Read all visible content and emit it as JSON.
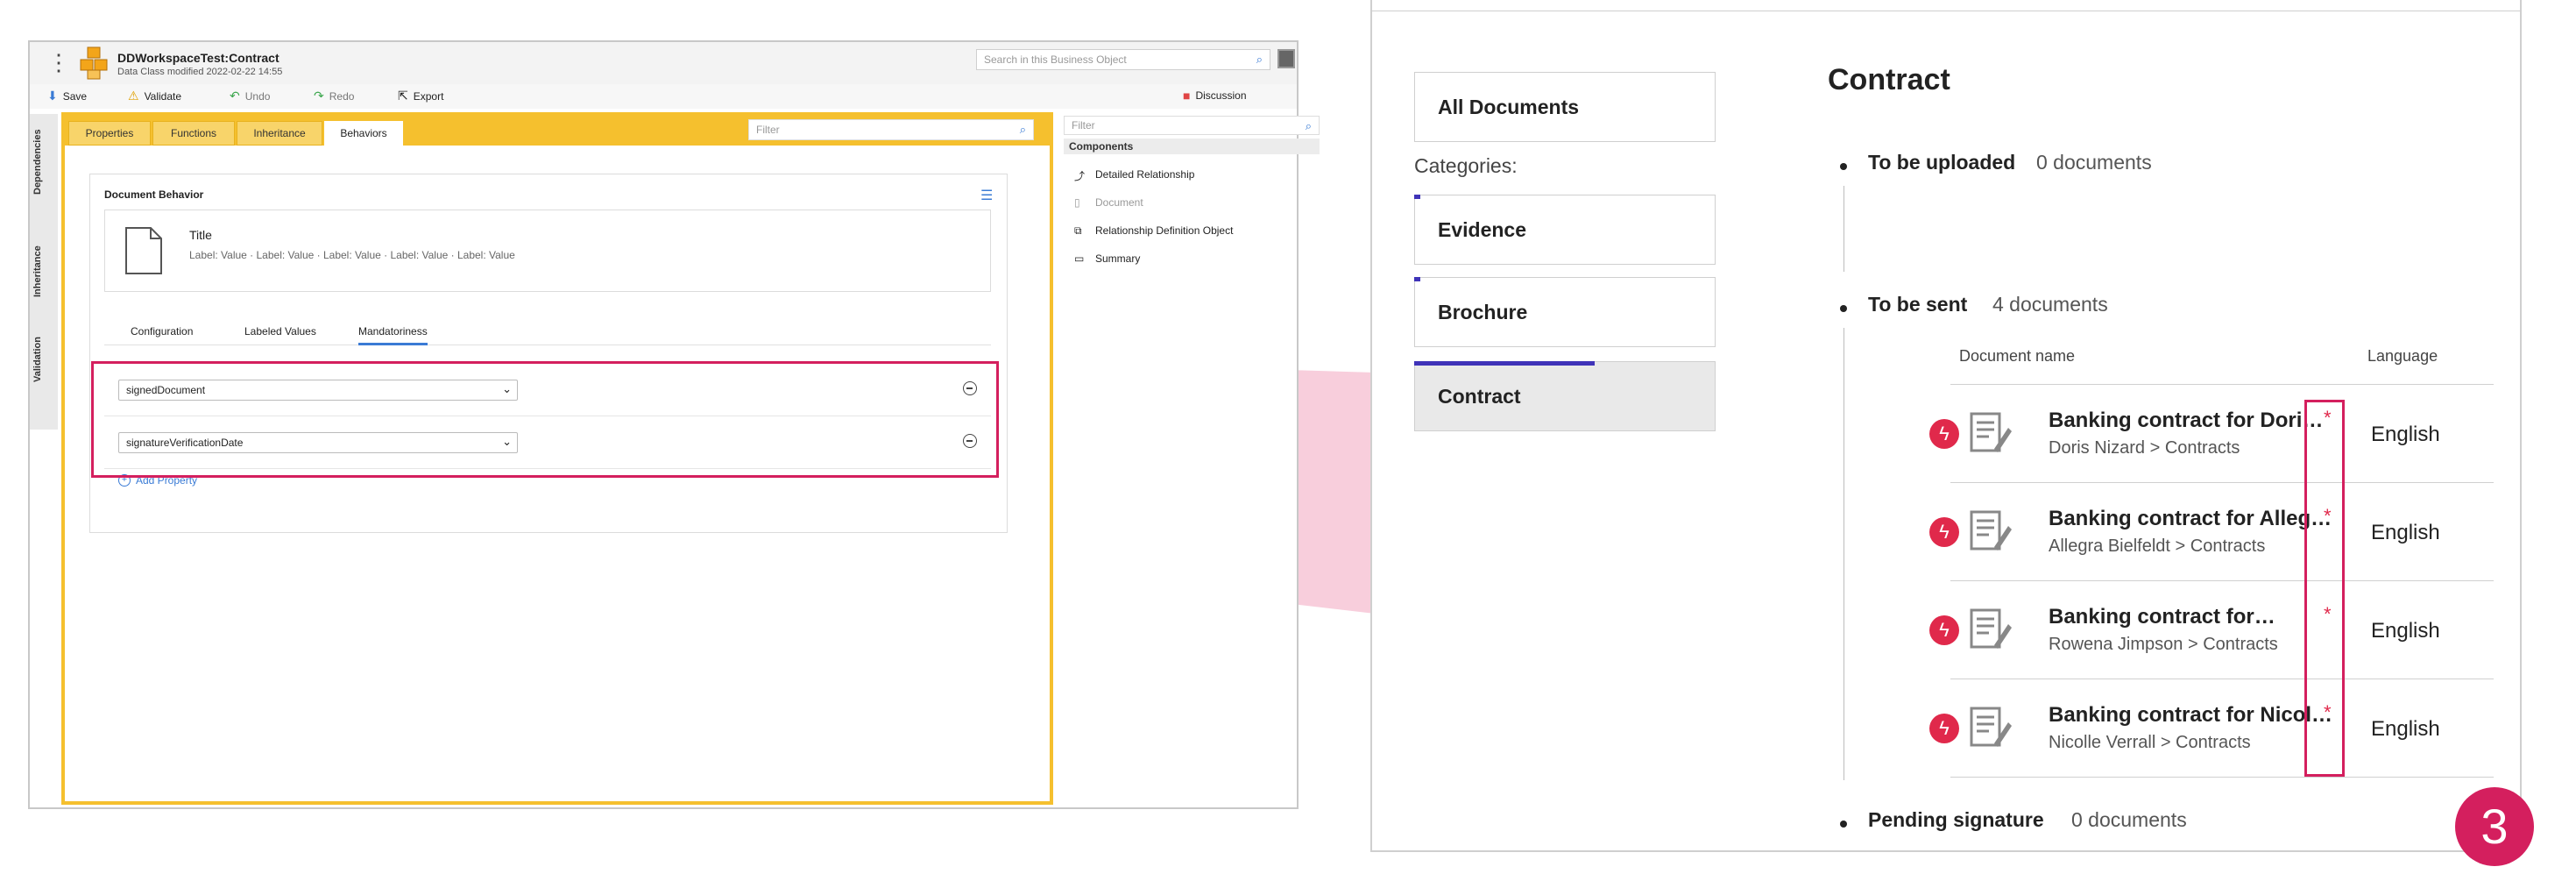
{
  "designer": {
    "title": "DDWorkspaceTest:Contract",
    "subtitle": "Data Class modified 2022-02-22 14:55",
    "search_placeholder": "Search in this Business Object",
    "toolbar": {
      "save": "Save",
      "validate": "Validate",
      "undo": "Undo",
      "redo": "Redo",
      "export": "Export",
      "discussion": "Discussion"
    },
    "side_tabs": [
      "Dependencies",
      "Inheritance",
      "Validation"
    ],
    "tabs": [
      "Properties",
      "Functions",
      "Inheritance",
      "Behaviors"
    ],
    "filter_placeholder": "Filter",
    "card": {
      "title": "Document Behavior",
      "doc_title": "Title",
      "doc_labels": "Label: Value · Label: Value · Label: Value · Label: Value · Label: Value",
      "subtabs": [
        "Configuration",
        "Labeled Values",
        "Mandatoriness"
      ],
      "properties": [
        "signedDocument",
        "signatureVerificationDate"
      ],
      "add_property": "Add Property"
    },
    "components": {
      "filter_placeholder": "Filter",
      "header": "Components",
      "items": [
        "Detailed Relationship",
        "Document",
        "Relationship Definition Object",
        "Summary"
      ]
    }
  },
  "panel": {
    "nav": {
      "all": "All Documents",
      "categories_label": "Categories:",
      "categories": [
        "Evidence",
        "Brochure",
        "Contract"
      ],
      "progress": [
        0.02,
        0.02,
        0.6
      ]
    },
    "title": "Contract",
    "sections": [
      {
        "label": "To be uploaded",
        "count": "0 documents"
      },
      {
        "label": "To be sent",
        "count": "4 documents"
      },
      {
        "label": "Pending signature",
        "count": "0 documents"
      }
    ],
    "table": {
      "col_name": "Document name",
      "col_lang": "Language",
      "rows": [
        {
          "name": "Banking contract for Dori…",
          "path": "Doris Nizard > Contracts",
          "lang": "English",
          "req": "*"
        },
        {
          "name": "Banking contract for Alleg…",
          "path": "Allegra Bielfeldt > Contracts",
          "lang": "English",
          "req": "*"
        },
        {
          "name": "Banking contract for…",
          "path": "Rowena Jimpson > Contracts",
          "lang": "English",
          "req": "*"
        },
        {
          "name": "Banking contract for Nicol…",
          "path": "Nicolle Verrall > Contracts",
          "lang": "English",
          "req": "*"
        }
      ]
    }
  },
  "step_number": "3",
  "colors": {
    "accent_yellow": "#f5c02e",
    "accent_blue": "#3a7bd5",
    "highlight": "#d41f5e",
    "highlight_fill": "#f7c6d6",
    "progress": "#3f33b8"
  }
}
